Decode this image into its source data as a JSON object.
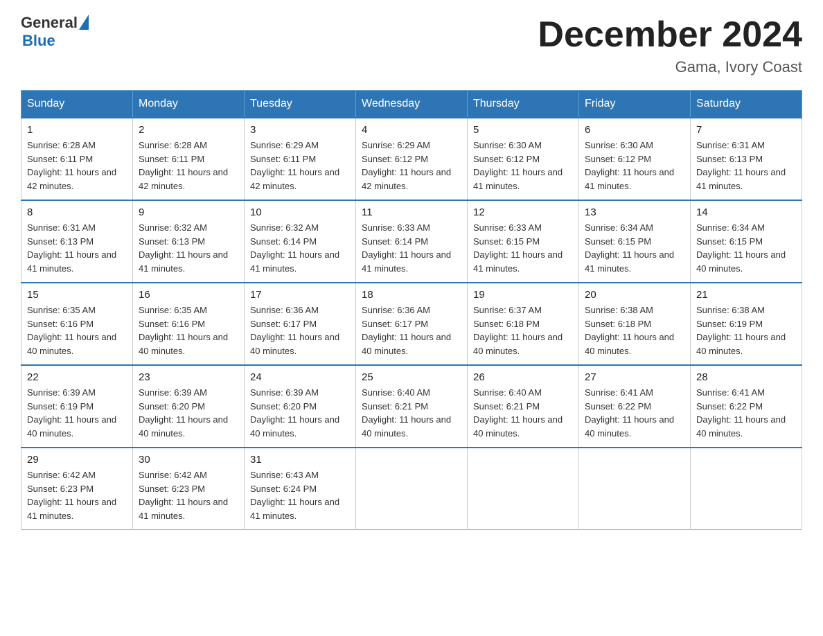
{
  "logo": {
    "name": "General",
    "name2": "Blue"
  },
  "title": "December 2024",
  "location": "Gama, Ivory Coast",
  "weekdays": [
    "Sunday",
    "Monday",
    "Tuesday",
    "Wednesday",
    "Thursday",
    "Friday",
    "Saturday"
  ],
  "weeks": [
    [
      {
        "day": "1",
        "sunrise": "6:28 AM",
        "sunset": "6:11 PM",
        "daylight": "11 hours and 42 minutes."
      },
      {
        "day": "2",
        "sunrise": "6:28 AM",
        "sunset": "6:11 PM",
        "daylight": "11 hours and 42 minutes."
      },
      {
        "day": "3",
        "sunrise": "6:29 AM",
        "sunset": "6:11 PM",
        "daylight": "11 hours and 42 minutes."
      },
      {
        "day": "4",
        "sunrise": "6:29 AM",
        "sunset": "6:12 PM",
        "daylight": "11 hours and 42 minutes."
      },
      {
        "day": "5",
        "sunrise": "6:30 AM",
        "sunset": "6:12 PM",
        "daylight": "11 hours and 41 minutes."
      },
      {
        "day": "6",
        "sunrise": "6:30 AM",
        "sunset": "6:12 PM",
        "daylight": "11 hours and 41 minutes."
      },
      {
        "day": "7",
        "sunrise": "6:31 AM",
        "sunset": "6:13 PM",
        "daylight": "11 hours and 41 minutes."
      }
    ],
    [
      {
        "day": "8",
        "sunrise": "6:31 AM",
        "sunset": "6:13 PM",
        "daylight": "11 hours and 41 minutes."
      },
      {
        "day": "9",
        "sunrise": "6:32 AM",
        "sunset": "6:13 PM",
        "daylight": "11 hours and 41 minutes."
      },
      {
        "day": "10",
        "sunrise": "6:32 AM",
        "sunset": "6:14 PM",
        "daylight": "11 hours and 41 minutes."
      },
      {
        "day": "11",
        "sunrise": "6:33 AM",
        "sunset": "6:14 PM",
        "daylight": "11 hours and 41 minutes."
      },
      {
        "day": "12",
        "sunrise": "6:33 AM",
        "sunset": "6:15 PM",
        "daylight": "11 hours and 41 minutes."
      },
      {
        "day": "13",
        "sunrise": "6:34 AM",
        "sunset": "6:15 PM",
        "daylight": "11 hours and 41 minutes."
      },
      {
        "day": "14",
        "sunrise": "6:34 AM",
        "sunset": "6:15 PM",
        "daylight": "11 hours and 40 minutes."
      }
    ],
    [
      {
        "day": "15",
        "sunrise": "6:35 AM",
        "sunset": "6:16 PM",
        "daylight": "11 hours and 40 minutes."
      },
      {
        "day": "16",
        "sunrise": "6:35 AM",
        "sunset": "6:16 PM",
        "daylight": "11 hours and 40 minutes."
      },
      {
        "day": "17",
        "sunrise": "6:36 AM",
        "sunset": "6:17 PM",
        "daylight": "11 hours and 40 minutes."
      },
      {
        "day": "18",
        "sunrise": "6:36 AM",
        "sunset": "6:17 PM",
        "daylight": "11 hours and 40 minutes."
      },
      {
        "day": "19",
        "sunrise": "6:37 AM",
        "sunset": "6:18 PM",
        "daylight": "11 hours and 40 minutes."
      },
      {
        "day": "20",
        "sunrise": "6:38 AM",
        "sunset": "6:18 PM",
        "daylight": "11 hours and 40 minutes."
      },
      {
        "day": "21",
        "sunrise": "6:38 AM",
        "sunset": "6:19 PM",
        "daylight": "11 hours and 40 minutes."
      }
    ],
    [
      {
        "day": "22",
        "sunrise": "6:39 AM",
        "sunset": "6:19 PM",
        "daylight": "11 hours and 40 minutes."
      },
      {
        "day": "23",
        "sunrise": "6:39 AM",
        "sunset": "6:20 PM",
        "daylight": "11 hours and 40 minutes."
      },
      {
        "day": "24",
        "sunrise": "6:39 AM",
        "sunset": "6:20 PM",
        "daylight": "11 hours and 40 minutes."
      },
      {
        "day": "25",
        "sunrise": "6:40 AM",
        "sunset": "6:21 PM",
        "daylight": "11 hours and 40 minutes."
      },
      {
        "day": "26",
        "sunrise": "6:40 AM",
        "sunset": "6:21 PM",
        "daylight": "11 hours and 40 minutes."
      },
      {
        "day": "27",
        "sunrise": "6:41 AM",
        "sunset": "6:22 PM",
        "daylight": "11 hours and 40 minutes."
      },
      {
        "day": "28",
        "sunrise": "6:41 AM",
        "sunset": "6:22 PM",
        "daylight": "11 hours and 40 minutes."
      }
    ],
    [
      {
        "day": "29",
        "sunrise": "6:42 AM",
        "sunset": "6:23 PM",
        "daylight": "11 hours and 41 minutes."
      },
      {
        "day": "30",
        "sunrise": "6:42 AM",
        "sunset": "6:23 PM",
        "daylight": "11 hours and 41 minutes."
      },
      {
        "day": "31",
        "sunrise": "6:43 AM",
        "sunset": "6:24 PM",
        "daylight": "11 hours and 41 minutes."
      },
      null,
      null,
      null,
      null
    ]
  ]
}
